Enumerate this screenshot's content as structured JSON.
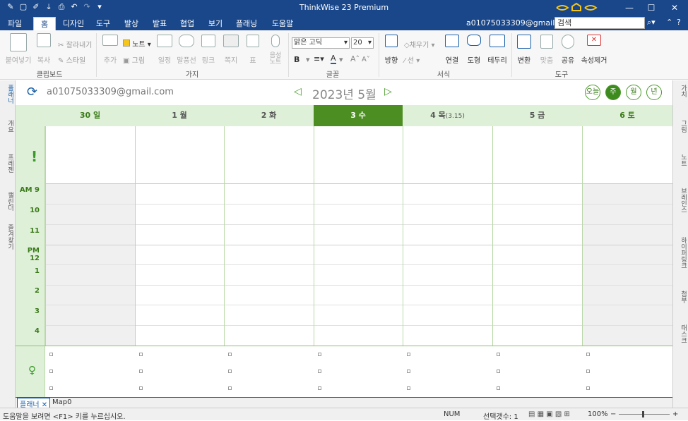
{
  "app": {
    "title": "ThinkWise 23 Premium"
  },
  "menu": {
    "tabs": [
      "파일",
      "홈",
      "디자인",
      "도구",
      "발상",
      "발표",
      "협업",
      "보기",
      "플래닝",
      "도움말"
    ],
    "account": "a01075033309@gmail.com",
    "search_placeholder": "검색"
  },
  "ribbon": {
    "paste": "붙여넣기",
    "copy": "복사",
    "cut": "잘라내기",
    "style": "스타일",
    "clipboard_group": "클립보드",
    "add": "추가",
    "note": "노트",
    "picture": "그림",
    "schedule": "일정",
    "balloon": "말풍선",
    "link": "링크",
    "memo": "쪽지",
    "table": "표",
    "voice_note": "음성 노트",
    "branch_group": "가지",
    "font_name": "맑은 고딕",
    "font_size": "20",
    "font_group": "글꼴",
    "direction": "방향",
    "fill": "채우기",
    "line": "선",
    "connect": "연결",
    "shape": "도형",
    "border": "테두리",
    "format_group": "서식",
    "convert": "변환",
    "fit": "맞춤",
    "share": "공유",
    "clear_props": "속성제거",
    "tools_group": "도구"
  },
  "left_tabs": [
    "플래너",
    "개요",
    "프레젠",
    "캘린더",
    "즐겨찾기"
  ],
  "right_tabs": [
    "가치",
    "그림",
    "노트",
    "브레인스",
    "하이퍼링크",
    "첨부",
    "태스크"
  ],
  "calendar": {
    "account": "a01075033309@gmail.com",
    "month_label": "2023년 5월",
    "view_buttons": [
      "오늘",
      "주",
      "월",
      "년"
    ],
    "days": [
      {
        "label": "30 일",
        "sub": ""
      },
      {
        "label": "1 월",
        "sub": ""
      },
      {
        "label": "2 화",
        "sub": ""
      },
      {
        "label": "3 수",
        "sub": ""
      },
      {
        "label": "4 목",
        "sub": "(3.15)"
      },
      {
        "label": "5 금",
        "sub": ""
      },
      {
        "label": "6 토",
        "sub": ""
      }
    ],
    "times": [
      "AM 9",
      "10",
      "11",
      "PM 12",
      "1",
      "2",
      "3",
      "4"
    ]
  },
  "doc_tabs": [
    "플래너",
    "Map0"
  ],
  "status": {
    "help": "도움말을 보려면 <F1> 키를 누르십시오.",
    "num": "NUM",
    "selection": "선택갯수: 1",
    "zoom": "100%"
  }
}
